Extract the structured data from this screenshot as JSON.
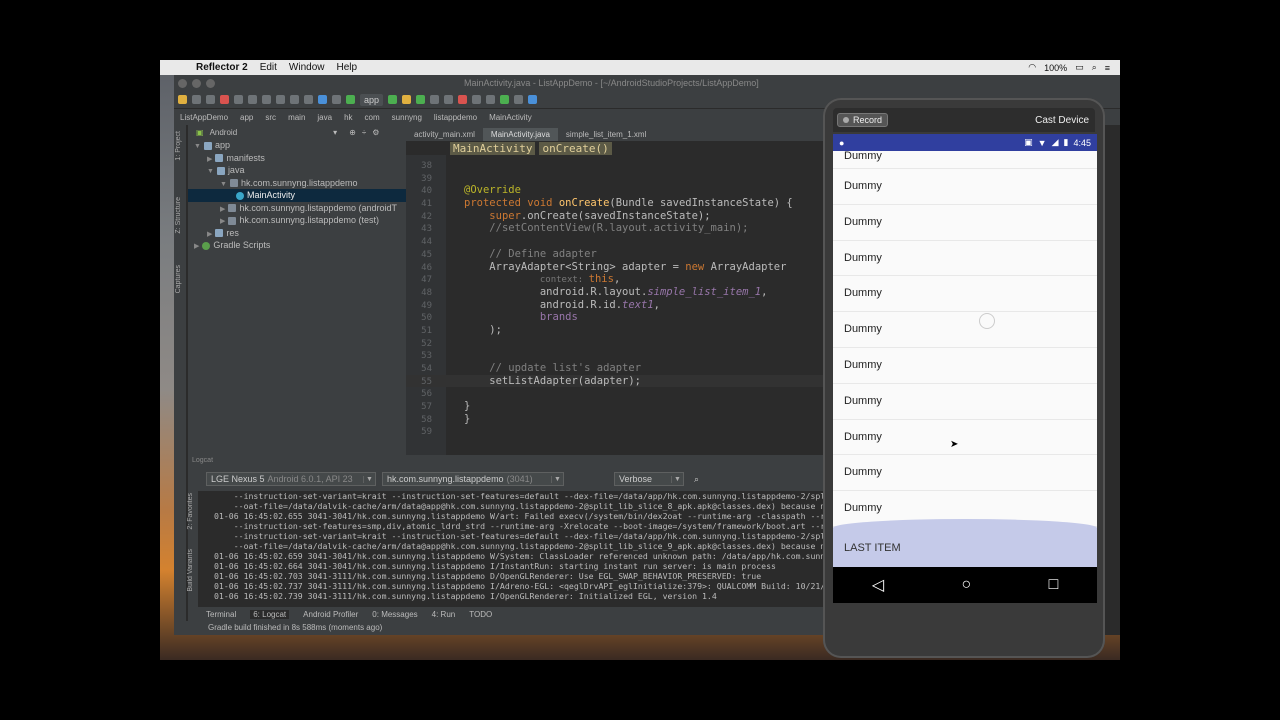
{
  "menubar": {
    "app": "Reflector 2",
    "items": [
      "Edit",
      "Window",
      "Help"
    ],
    "battery": "100%",
    "time_hint": ""
  },
  "ide": {
    "title": "MainActivity.java - ListAppDemo - [~/AndroidStudioProjects/ListAppDemo]",
    "toolbar_app": "app",
    "nav_crumbs": [
      "ListAppDemo",
      "app",
      "src",
      "main",
      "java",
      "hk",
      "com",
      "sunnyng",
      "listappdemo",
      "MainActivity"
    ],
    "left_tabs": [
      "1: Project",
      "Z: Structure",
      "Captures"
    ],
    "project_view": "Android",
    "tree": [
      {
        "label": "app",
        "indent": 0,
        "arrow": "▼",
        "icon": "folder"
      },
      {
        "label": "manifests",
        "indent": 1,
        "arrow": "▶",
        "icon": "folder"
      },
      {
        "label": "java",
        "indent": 1,
        "arrow": "▼",
        "icon": "folder"
      },
      {
        "label": "hk.com.sunnyng.listappdemo",
        "indent": 2,
        "arrow": "▼",
        "icon": "pkg"
      },
      {
        "label": "MainActivity",
        "indent": 3,
        "arrow": "",
        "icon": "cls",
        "selected": true
      },
      {
        "label": "hk.com.sunnyng.listappdemo (androidT",
        "indent": 2,
        "arrow": "▶",
        "icon": "pkg"
      },
      {
        "label": "hk.com.sunnyng.listappdemo (test)",
        "indent": 2,
        "arrow": "▶",
        "icon": "pkg"
      },
      {
        "label": "res",
        "indent": 1,
        "arrow": "▶",
        "icon": "folder"
      },
      {
        "label": "Gradle Scripts",
        "indent": 0,
        "arrow": "▶",
        "icon": "gr"
      }
    ],
    "editor_tabs": [
      "activity_main.xml",
      "MainActivity.java",
      "simple_list_item_1.xml"
    ],
    "breadcrumbs": [
      "MainActivity",
      "onCreate()"
    ],
    "code": [
      {
        "n": "38",
        "html": ""
      },
      {
        "n": "39",
        "html": ""
      },
      {
        "n": "40",
        "html": "<span class='ann'>@Override</span>"
      },
      {
        "n": "41",
        "html": "<span class='kw'>protected void </span><span class='fn'>onCreate</span>(Bundle savedInstanceState) {"
      },
      {
        "n": "42",
        "html": "    <span class='kw'>super</span>.onCreate(savedInstanceState);"
      },
      {
        "n": "43",
        "html": "    <span class='cm'>//setContentView(R.layout.activity_main);</span>"
      },
      {
        "n": "44",
        "html": ""
      },
      {
        "n": "45",
        "html": "    <span class='cm'>// Define adapter</span>"
      },
      {
        "n": "46",
        "html": "    ArrayAdapter&lt;String&gt; adapter = <span class='kw'>new </span>ArrayAdapter"
      },
      {
        "n": "47",
        "html": "            <span class='hint'>context: </span><span class='kw'>this</span>,"
      },
      {
        "n": "48",
        "html": "            android.R.layout.<span class='it'>simple_list_item_1</span>,"
      },
      {
        "n": "49",
        "html": "            android.R.id.<span class='it'>text1</span>,"
      },
      {
        "n": "50",
        "html": "            <span class='fld'>brands</span>"
      },
      {
        "n": "51",
        "html": "    );"
      },
      {
        "n": "52",
        "html": ""
      },
      {
        "n": "53",
        "html": ""
      },
      {
        "n": "54",
        "html": "    <span class='cm'>// update list's adapter</span>"
      },
      {
        "n": "55",
        "html": "    setListAdapter(adapter);",
        "current": true
      },
      {
        "n": "56",
        "html": ""
      },
      {
        "n": "57",
        "html": "}"
      },
      {
        "n": "58",
        "html": "}"
      },
      {
        "n": "59",
        "html": ""
      }
    ],
    "logcat_label": "Logcat",
    "device": "LGE Nexus 5",
    "device_dim": "Android 6.0.1, API 23",
    "process": "hk.com.sunnyng.listappdemo",
    "process_dim": "(3041)",
    "level": "Verbose",
    "log_lines": [
      "    --instruction-set-variant=krait --instruction-set-features=default --dex-file=/data/app/hk.com.sunnyng.listappdemo-2/split_lib_s",
      "    --oat-file=/data/dalvik-cache/arm/data@app@hk.com.sunnyng.listappdemo-2@split_lib_slice_8_apk.apk@classes.dex) because non-0 exit",
      "01-06 16:45:02.655 3041-3041/hk.com.sunnyng.listappdemo W/art: Failed execv(/system/bin/dex2oat --runtime-arg -classpath --runtime",
      "    --instruction-set-features=smp,div,atomic_ldrd_strd --runtime-arg -Xrelocate --boot-image=/system/framework/boot.art --runtime-a",
      "    --instruction-set-variant=krait --instruction-set-features=default --dex-file=/data/app/hk.com.sunnyng.listappdemo-2/split_lib_s",
      "    --oat-file=/data/dalvik-cache/arm/data@app@hk.com.sunnyng.listappdemo-2@split_lib_slice_9_apk.apk@classes.dex) because non-0 exit",
      "01-06 16:45:02.659 3041-3041/hk.com.sunnyng.listappdemo W/System: ClassLoader referenced unknown path: /data/app/hk.com.sunnyng.li",
      "01-06 16:45:02.664 3041-3041/hk.com.sunnyng.listappdemo I/InstantRun: starting instant run server: is main process",
      "01-06 16:45:02.703 3041-3111/hk.com.sunnyng.listappdemo D/OpenGLRenderer: Use EGL_SWAP_BEHAVIOR_PRESERVED: true",
      "01-06 16:45:02.737 3041-3111/hk.com.sunnyng.listappdemo I/Adreno-EGL: <qeglDrvAPI_eglInitialize:379>: QUALCOMM Build: 10/21/15, 36",
      "01-06 16:45:02.739 3041-3111/hk.com.sunnyng.listappdemo I/OpenGLRenderer: Initialized EGL, version 1.4"
    ],
    "log_strip_tabs": [
      "2: Favorites",
      "Build Variants"
    ],
    "bottom_tabs": [
      "Terminal",
      "6: Logcat",
      "Android Profiler",
      "0: Messages",
      "4: Run",
      "TODO"
    ],
    "status": "Gradle build finished in 8s 588ms (moments ago)"
  },
  "phone": {
    "record": "Record",
    "cast_device": "Cast Device",
    "clock": "4:45",
    "items": [
      "Dummy",
      "Dummy",
      "Dummy",
      "Dummy",
      "Dummy",
      "Dummy",
      "Dummy",
      "Dummy",
      "Dummy",
      "Dummy",
      "Dummy"
    ],
    "last_item": "LAST ITEM",
    "nav": {
      "back": "◁",
      "home": "○",
      "recent": "□"
    }
  }
}
